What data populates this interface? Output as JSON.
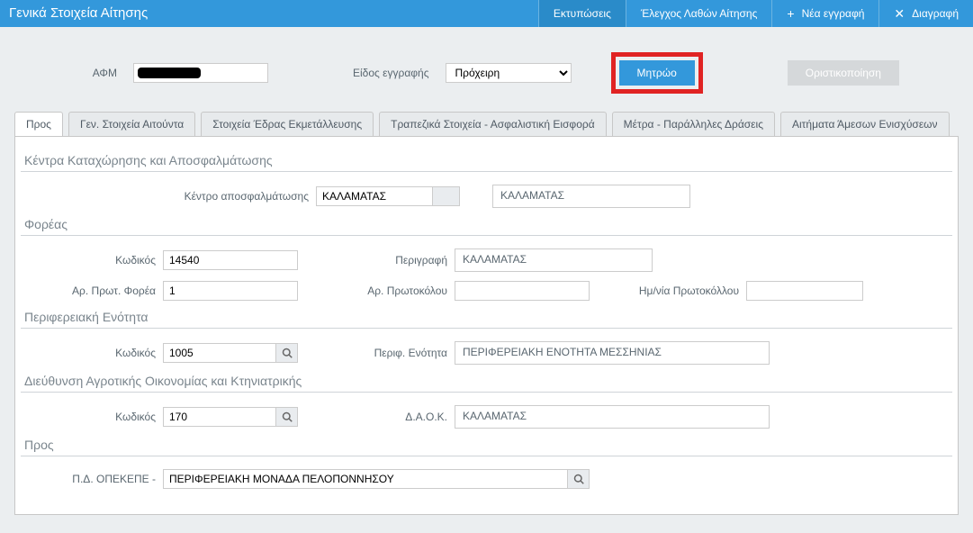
{
  "header": {
    "title": "Γενικά Στοιχεία Αίτησης",
    "buttons": {
      "print": "Εκτυπώσεις",
      "check": "Έλεγχος Λαθών Αίτησης",
      "new": "Νέα εγγραφή",
      "delete": "Διαγραφή"
    }
  },
  "topbar": {
    "afm_label": "ΑΦΜ",
    "eidos_label": "Είδος εγγραφής",
    "eidos_value": "Πρόχειρη",
    "mitroo_btn": "Μητρώο",
    "oristiko_btn": "Οριστικοποίηση"
  },
  "tabs": {
    "t0": "Προς",
    "t1": "Γεν. Στοιχεία Αιτούντα",
    "t2": "Στοιχεία Έδρας Εκμετάλλευσης",
    "t3": "Τραπεζικά Στοιχεία - Ασφαλιστική Εισφορά",
    "t4": "Μέτρα - Παράλληλες Δράσεις",
    "t5": "Αιτήματα Άμεσων Ενισχύσεων"
  },
  "sections": {
    "kentra": {
      "title": "Κέντρα Καταχώρησης και Αποσφαλμάτωσης",
      "label": "Κέντρο αποσφαλμάτωσης",
      "val": "ΚΑΛΑΜΑΤΑΣ",
      "desc": "ΚΑΛΑΜΑΤΑΣ"
    },
    "foreas": {
      "title": "Φορέας",
      "kodikos_label": "Κωδικός",
      "kodikos": "14540",
      "perigrafi_label": "Περιγραφή",
      "perigrafi": "ΚΑΛΑΜΑΤΑΣ",
      "arprot_forea_label": "Αρ. Πρωτ. Φορέα",
      "arprot_forea": "1",
      "arprot_label": "Αρ. Πρωτοκόλου",
      "arprot": "",
      "hmnia_label": "Ημ/νία Πρωτοκόλλου",
      "hmnia": ""
    },
    "perif": {
      "title": "Περιφερειακή Ενότητα",
      "kodikos_label": "Κωδικός",
      "kodikos": "1005",
      "enotita_label": "Περιφ. Ενότητα",
      "enotita": "ΠΕΡΙΦΕΡΕΙΑΚΗ ΕΝΟΤΗΤΑ ΜΕΣΣΗΝΙΑΣ"
    },
    "daok": {
      "title": "Διεύθυνση Αγροτικής Οικονομίας και Κτηνιατρικής",
      "kodikos_label": "Κωδικός",
      "kodikos": "170",
      "daok_label": "Δ.Α.Ο.Κ.",
      "daok": "ΚΑΛΑΜΑΤΑΣ"
    },
    "pros": {
      "title": "Προς",
      "label": "Π.Δ. ΟΠΕΚΕΠΕ -",
      "val": "ΠΕΡΙΦΕΡΕΙΑΚΗ ΜΟΝΑΔΑ ΠΕΛΟΠΟΝΝΗΣΟΥ"
    }
  }
}
